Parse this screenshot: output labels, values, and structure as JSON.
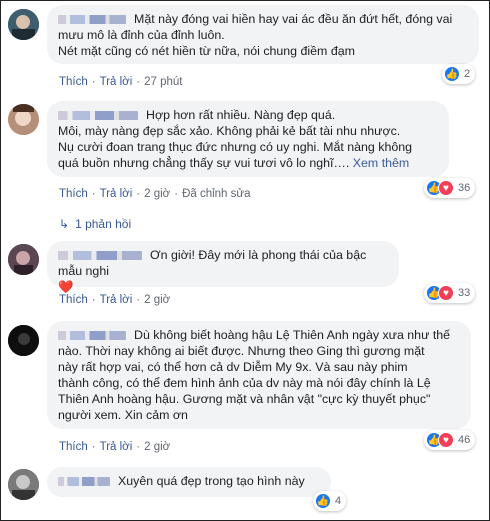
{
  "comments": [
    {
      "text_lines": [
        "Mặt này đóng vai hiền hay vai ác đều ăn đứt hết, đóng vai",
        "mưu mô là đỉnh của đỉnh luôn.",
        "Nét mặt cũng có nét hiền từ nữa, nói chung điềm đạm"
      ],
      "like": "Thích",
      "reply": "Trả lời",
      "time": "27 phút",
      "reactions": [
        "like"
      ],
      "count": "2"
    },
    {
      "text_lines": [
        "Hợp hơn rất nhiều. Nàng đẹp quá.",
        "Môi, mày nàng đẹp sắc xảo. Không phải kẻ bất tài nhu nhược.",
        "Nụ cười đoan trang thục đức nhưng có uy nghi. Mắt nàng không",
        "quá buồn nhưng chẳng thấy sự vui tươi vô lo nghĩ…."
      ],
      "see_more": "Xem thêm",
      "like": "Thích",
      "reply": "Trả lời",
      "time": "2 giờ",
      "edited": "Đã chỉnh sửa",
      "reactions": [
        "like",
        "love"
      ],
      "count": "36",
      "replies_label": "1 phản hồi"
    },
    {
      "text_lines": [
        "Ơn giời! Đây mới là phong thái của bậc mẫu nghi"
      ],
      "emoji": "❤️",
      "like": "Thích",
      "reply": "Trả lời",
      "time": "2 giờ",
      "reactions": [
        "like",
        "love"
      ],
      "count": "33"
    },
    {
      "text_lines": [
        "Dù không biết hoàng hậu Lệ Thiên Anh ngày xưa như thế",
        "nào. Thời nay không ai biết được. Nhưng theo Ging thì gương mặt",
        "này rất hợp vai, có thể hơn cả dv Diễm My 9x. Và sau này phim",
        "thành công, có thể đem hình ảnh của dv này mà nói đây chính là Lệ",
        "Thiên Anh hoàng hậu. Gương mặt và nhân vật \"cực kỳ thuyết phục\"",
        "người xem. Xin cảm ơn"
      ],
      "like": "Thích",
      "reply": "Trả lời",
      "time": "2 giờ",
      "reactions": [
        "like",
        "love"
      ],
      "count": "46"
    },
    {
      "text_lines": [
        "Xuyên quá đẹp trong tạo hình này"
      ],
      "reactions": [
        "like"
      ],
      "count": "4"
    }
  ],
  "colors": {
    "link": "#385898",
    "like": "#1877f2",
    "love": "#f33e58",
    "bubble": "#f2f3f5"
  }
}
